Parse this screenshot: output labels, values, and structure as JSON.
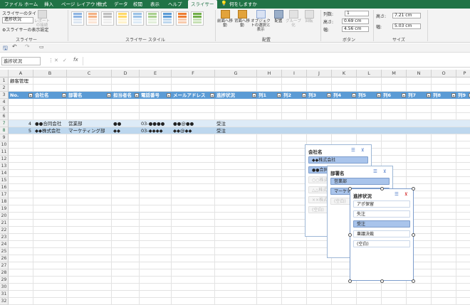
{
  "menubar": {
    "tabs": [
      "ファイル",
      "ホーム",
      "挿入",
      "ページ レイアウト",
      "数式",
      "データ",
      "校閲",
      "表示",
      "ヘルプ",
      "スライサー",
      "何をしますか"
    ],
    "active": "スライサー"
  },
  "ribbon": {
    "slicer_title_label": "スライサーのタイトル:",
    "slicer_title_value": "進捗状況",
    "report_connection": "レポートの接続",
    "display_settings": "スライサーの表示設定",
    "group_slicer": "スライサー",
    "group_styles": "スライサー スタイル",
    "bring_forward": "前面へ移動",
    "send_backward": "背面へ移動",
    "selection_pane": "オブジェクトの選択と表示",
    "align": "配置",
    "group_btn": "グループ化",
    "rotate": "回転",
    "group_arrange": "配置",
    "columns_label": "列数:",
    "columns_value": "1",
    "height_label": "高さ:",
    "height_value": "0.69 cm",
    "width_label": "幅:",
    "width_value": "4.56 cm",
    "group_buttons": "ボタン",
    "size_height_label": "高さ:",
    "size_height_value": "7.21 cm",
    "size_width_label": "幅:",
    "size_width_value": "5.03 cm",
    "group_size": "サイズ",
    "accent": "#217346"
  },
  "formula": {
    "namebox": "進捗状況",
    "fx": "fx"
  },
  "columns": [
    "A",
    "B",
    "C",
    "D",
    "E",
    "F",
    "G",
    "H",
    "I",
    "J",
    "K",
    "L",
    "M",
    "N",
    "O",
    "P"
  ],
  "rows": [
    "1",
    "2",
    "3",
    "4",
    "5",
    "6",
    "7",
    "8",
    "9",
    "10",
    "11",
    "12",
    "13",
    "14",
    "15",
    "16",
    "17",
    "18",
    "19",
    "20",
    "21",
    "22",
    "23",
    "24",
    "25",
    "26",
    "27",
    "28",
    "29",
    "30",
    "31",
    "32"
  ],
  "sheet": {
    "title": "顧客管理",
    "headers": [
      "No.",
      "会社名",
      "部署名",
      "担当者名",
      "電話番号",
      "メールアドレス",
      "進捗状況",
      "列1",
      "列2",
      "列3",
      "列4",
      "列5",
      "列6",
      "列7",
      "列8",
      "列9"
    ],
    "row7": [
      "4",
      "●●合同会社",
      "営業部",
      "●●",
      "03-●●●●",
      "●●@●●",
      "受注"
    ],
    "row8": [
      "5",
      "◆◆株式会社",
      "マーケティング部",
      "◆◆",
      "03-◆◆◆◆",
      "◆◆@◆◆",
      "受注"
    ]
  },
  "slicer_company": {
    "title": "会社名",
    "items": [
      "◆◆株式会社",
      "●●合同会社",
      "○○株式会社",
      "△△株式会社",
      "××株式会社",
      "(空白)"
    ]
  },
  "slicer_dept": {
    "title": "部署名",
    "items": [
      "営業部",
      "マーケティング部",
      "(空白)"
    ]
  },
  "slicer_status": {
    "title": "進捗状況",
    "items": [
      "アポ保留",
      "失注",
      "受注",
      "稟議決裁",
      "(空白)"
    ]
  }
}
